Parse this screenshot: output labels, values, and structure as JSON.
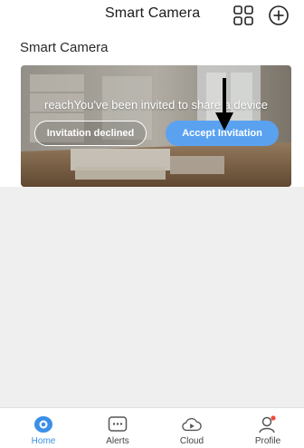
{
  "header": {
    "title": "Smart Camera",
    "icons": [
      "grid-icon",
      "add-icon"
    ]
  },
  "section": {
    "title": "Smart Camera"
  },
  "card": {
    "invite_text": "reachYou've been invited to share a device",
    "decline_label": "Invitation declined",
    "accept_label": "Accept Invitation"
  },
  "nav": {
    "items": [
      {
        "label": "Home",
        "icon": "home-camera-icon",
        "active": true
      },
      {
        "label": "Alerts",
        "icon": "alerts-icon",
        "active": false
      },
      {
        "label": "Cloud",
        "icon": "cloud-icon",
        "active": false
      },
      {
        "label": "Profile",
        "icon": "profile-icon",
        "active": false
      }
    ]
  },
  "colors": {
    "accent": "#3a8fe8",
    "accept_button": "#5aa2f0",
    "background": "#efefef",
    "badge": "#f04a3a"
  }
}
